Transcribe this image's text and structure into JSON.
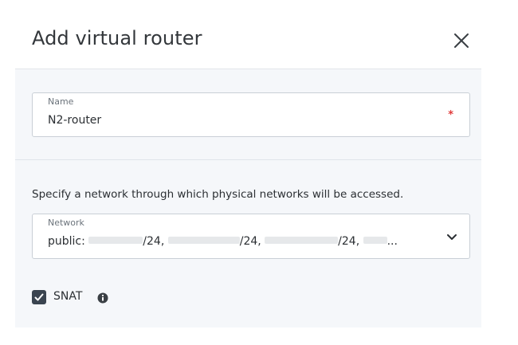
{
  "dialog": {
    "title": "Add virtual router"
  },
  "name_field": {
    "label": "Name",
    "value": "N2-router",
    "required_marker": "*"
  },
  "network_section": {
    "hint": "Specify a network through which physical networks will be accessed.",
    "field_label": "Network",
    "value_prefix": "public: ",
    "segments": [
      "/24, ",
      "/24, ",
      "/24, "
    ],
    "ellipsis": "..."
  },
  "snat": {
    "label": "SNAT",
    "checked": true
  },
  "icons": {
    "close": "close-icon",
    "dropdown": "chevron-down-icon",
    "info": "info-icon",
    "check": "check-icon"
  },
  "colors": {
    "background": "#ffffff",
    "panel": "#f5f7fa",
    "border": "#c9cfd6",
    "required": "#e03a3a",
    "checkbox": "#3a4450"
  }
}
